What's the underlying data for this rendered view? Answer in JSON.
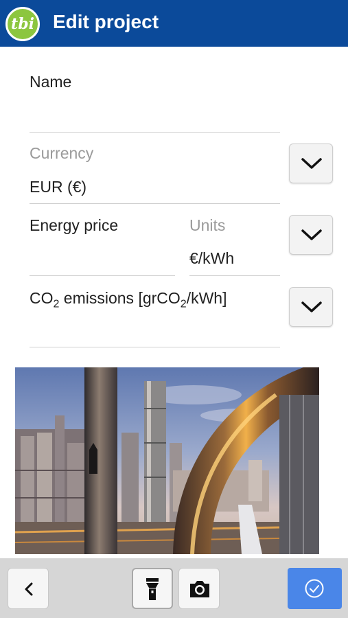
{
  "app": {
    "logo_text": "tbi",
    "title": "Edit project"
  },
  "form": {
    "name": {
      "label": "Name",
      "value": ""
    },
    "currency": {
      "label": "Currency",
      "value": "EUR  (€)"
    },
    "energy_price": {
      "label": "Energy price",
      "value": ""
    },
    "units": {
      "label": "Units",
      "value": "€/kWh"
    },
    "co2": {
      "label_prefix": "CO",
      "sub1": "2",
      "label_mid": " emissions [grCO",
      "sub2": "2",
      "label_suffix": "/kWh]",
      "value": ""
    }
  },
  "icons": {
    "currency_dropdown": "chevron-down-icon",
    "units_dropdown": "chevron-down-icon",
    "co2_dropdown": "chevron-down-icon",
    "back": "chevron-left-icon",
    "flashlight": "flashlight-icon",
    "camera": "camera-icon",
    "confirm": "check-circle-icon"
  },
  "colors": {
    "appbar": "#0b4a9a",
    "logo": "#8cc63f",
    "confirm": "#4a86e8",
    "bottombar": "#d6d6d6"
  }
}
